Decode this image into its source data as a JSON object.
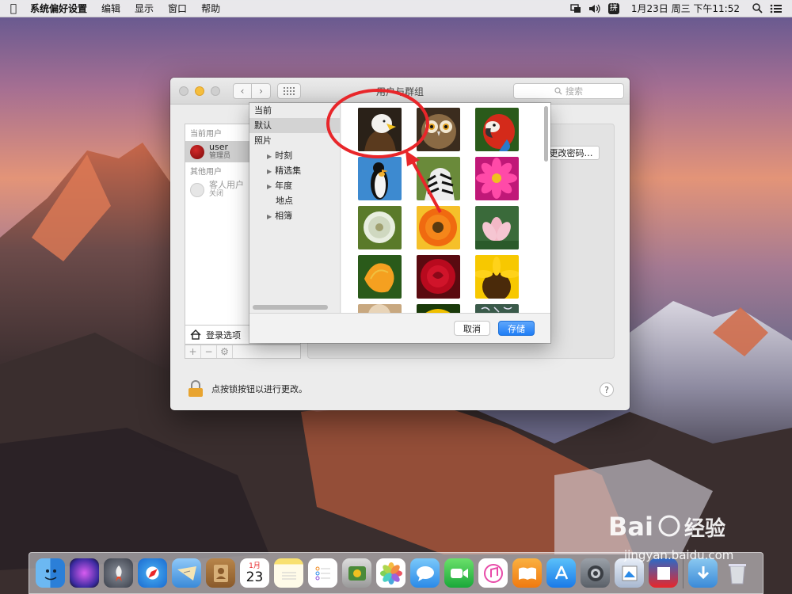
{
  "menubar": {
    "app_name": "系统偏好设置",
    "items": [
      "编辑",
      "显示",
      "窗口",
      "帮助"
    ],
    "clock": "1月23日 周三 下午11:52",
    "ime": "拼"
  },
  "window": {
    "title": "用户与群组",
    "search_placeholder": "搜索",
    "user_list": {
      "current_section": "当前用户",
      "current_user": {
        "name": "user",
        "role": "管理员"
      },
      "other_section": "其他用户",
      "guest_user": {
        "name": "客人用户",
        "status": "关闭"
      },
      "login_options": "登录选项"
    },
    "change_password_button": "更改密码…",
    "lock_text": "点按锁按钮以进行更改。",
    "help": "?"
  },
  "picker": {
    "sources": [
      {
        "label": "当前",
        "selected": false,
        "sub": false,
        "tri": false
      },
      {
        "label": "默认",
        "selected": true,
        "sub": false,
        "tri": false
      },
      {
        "label": "照片",
        "selected": false,
        "sub": false,
        "tri": false
      },
      {
        "label": "时刻",
        "selected": false,
        "sub": true,
        "tri": true
      },
      {
        "label": "精选集",
        "selected": false,
        "sub": true,
        "tri": true
      },
      {
        "label": "年度",
        "selected": false,
        "sub": true,
        "tri": true
      },
      {
        "label": "地点",
        "selected": false,
        "sub": true,
        "tri": false
      },
      {
        "label": "相簿",
        "selected": false,
        "sub": true,
        "tri": true
      }
    ],
    "images": [
      "eagle",
      "owl",
      "parrot",
      "penguin",
      "zebra",
      "pink-flower",
      "dandelion",
      "orange-gerbera",
      "lotus",
      "orange-poppy",
      "red-rose",
      "sunflower",
      "shell",
      "leaf",
      "chalkboard"
    ],
    "cancel_button": "取消",
    "save_button": "存储"
  },
  "annotation_color": "#e8262a",
  "dock_apps": [
    "finder",
    "siri",
    "launchpad",
    "safari",
    "mail",
    "contacts",
    "calendar",
    "notes",
    "reminders",
    "photo-booth",
    "photos",
    "messages",
    "facetime",
    "itunes",
    "ibooks",
    "app-store",
    "system-preferences",
    "preview",
    "photo-booth-2",
    "downloads",
    "trash"
  ],
  "dock_calendar": {
    "month": "1月",
    "day": "23"
  }
}
